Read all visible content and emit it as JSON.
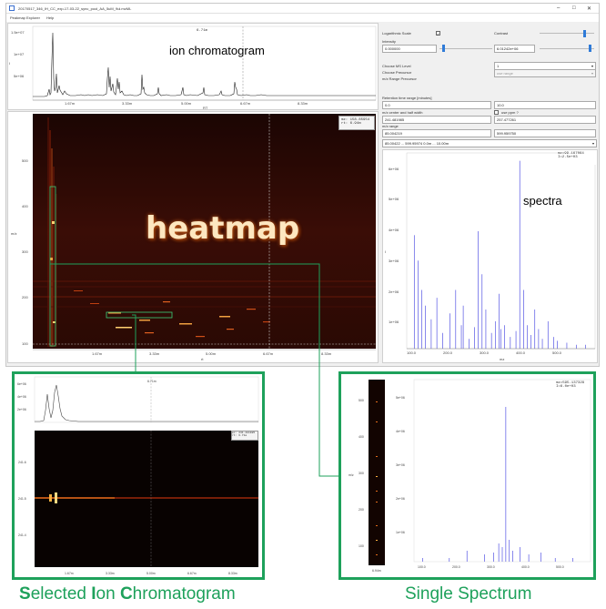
{
  "window": {
    "title": "20170517_346_IH_CC_exp-17-03-22_sync_pool_AA_5uM_9ul.mzML",
    "minimize": "–",
    "maximize": "□",
    "close": "✕"
  },
  "menu": {
    "items": [
      "Peakmap Explorer",
      "Help"
    ]
  },
  "chromatogram": {
    "annotation": "ion chromatogram",
    "rt_marker": "6.71m",
    "y_ticks": [
      "1.5e+07",
      "1e+07",
      "5e+06"
    ],
    "y_label": "I",
    "x_ticks": [
      "1.67m",
      "3.33m",
      "5.00m",
      "6.67m",
      "8.33m"
    ],
    "x_label": "RT"
  },
  "heatmap": {
    "annotation": "heatmap",
    "readout_mz": "mz: 158.85954",
    "readout_rt": "rt:   6.94m",
    "y_ticks": [
      "500",
      "400",
      "300",
      "200",
      "100"
    ],
    "y_label": "m/z",
    "x_ticks": [
      "1.67m",
      "3.33m",
      "5.00m",
      "6.67m",
      "8.33m"
    ],
    "x_label": "rt"
  },
  "controls": {
    "log_scale_label": "Logarithmic Scale",
    "log_scale_checked": true,
    "contrast_label": "Contrast",
    "intensity_label": "Intensity",
    "intensity_min": "0.000000",
    "intensity_max": "6.01242e+06",
    "ms_level_label": "Choose MS Level",
    "ms_level_value": "1",
    "precursor_label": "Choose Precursor",
    "precursor_value": "use range",
    "precursor_range_label": "m/z Range Precursor",
    "rt_range_label": "Retention time range [minutes]",
    "rt_min": "0.0",
    "rt_max": "10.0",
    "mz_center_label": "m/z center and half width",
    "use_ppm_label": "use ppm ?",
    "mz_center": "241.481985",
    "mz_half_width": "257.477261",
    "mz_range_label": "m/z range",
    "mz_min": "85.004219",
    "mz_max": "599.959750",
    "range_dropdown": "85.00422 ... 599.95974 0.0m ... 10.00m"
  },
  "spectra": {
    "annotation": "spectra",
    "readout_mz": "mz=99.167064",
    "readout_i": "I=2.5e+03",
    "y_ticks": [
      "6e+06",
      "5e+06",
      "4e+06",
      "3e+06",
      "2e+06",
      "1e+06"
    ],
    "y_label": "I",
    "x_ticks": [
      "100.0",
      "200.0",
      "300.0",
      "400.0",
      "500.0"
    ],
    "x_label": "mz"
  },
  "sic_panel": {
    "rt_marker": "6.71m",
    "y_ticks": [
      "6e+06",
      "4e+06",
      "2e+06"
    ],
    "mz_readout": "mz: 241.481985",
    "rt_readout": "rt:   6.71m",
    "heat_y_ticks": [
      "241.6",
      "241.5",
      "241.4"
    ],
    "x_ticks": [
      "1.67m",
      "3.33m",
      "5.00m",
      "6.67m",
      "8.33m"
    ]
  },
  "single_panel": {
    "readout_mz": "mz=595.137329",
    "readout_i": "I=6.0e+03",
    "y_ticks": [
      "5e+06",
      "4e+06",
      "3e+06",
      "2e+06",
      "1e+06"
    ],
    "heat_y_ticks": [
      "500",
      "400",
      "300",
      "200",
      "100"
    ],
    "heat_x_tick": "6.94m",
    "x_ticks": [
      "100.0",
      "200.0",
      "300.0",
      "400.0",
      "500.0"
    ],
    "y_label": "m/z"
  },
  "captions": {
    "sic_1": "S",
    "sic_2": "elected ",
    "sic_3": "I",
    "sic_4": "on ",
    "sic_5": "C",
    "sic_6": "hromatogram",
    "single": "Single Spectrum"
  },
  "colors": {
    "accent_green": "#1ea15b",
    "heatmap_bg": "#2a0b05",
    "spectrum_blue": "#3a3adf"
  }
}
